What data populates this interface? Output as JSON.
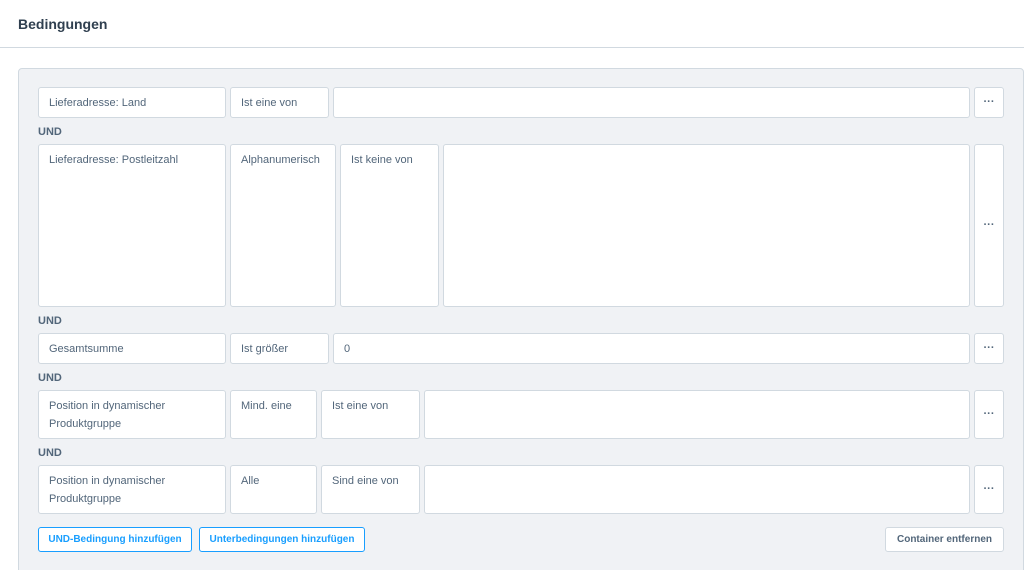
{
  "page": {
    "title": "Bedingungen"
  },
  "conditions": [
    {
      "field": "Lieferadresse: Land",
      "operator": "Ist eine von",
      "value": ""
    },
    {
      "field": "Lieferadresse: Postleitzahl",
      "type": "Alphanumerisch",
      "operator": "Ist keine von",
      "value": ""
    },
    {
      "field": "Gesamtsumme",
      "operator": "Ist größer",
      "value": "0"
    },
    {
      "field": "Position in dynamischer Produktgruppe",
      "quantifier": "Mind. eine",
      "operator": "Ist eine von",
      "value": ""
    },
    {
      "field": "Position in dynamischer Produktgruppe",
      "quantifier": "Alle",
      "operator": "Sind eine von",
      "value": ""
    }
  ],
  "connector": "UND",
  "more_label": "···",
  "actions": {
    "add_and": "UND-Bedingung hinzufügen",
    "add_sub": "Unterbedingungen hinzufügen",
    "remove_container": "Container entfernen"
  }
}
